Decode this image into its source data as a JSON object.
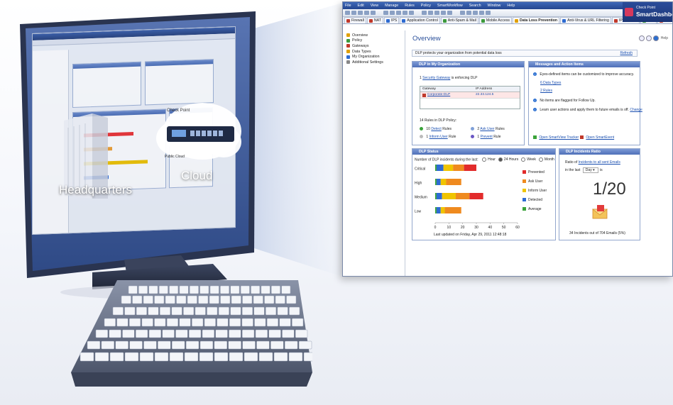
{
  "illustration": {
    "headquarters_label": "Headquarters",
    "cloud_label": "Cloud",
    "cloud_brand": "Check Point",
    "public_cloud_label": "Public Cloud"
  },
  "window": {
    "menu": [
      "File",
      "Edit",
      "View",
      "Manage",
      "Rules",
      "Policy",
      "SmartWorkflow",
      "Search",
      "Window",
      "Help"
    ],
    "brand_top": "Check Point",
    "brand_main": "SmartDashboard",
    "tabs": [
      {
        "label": "Firewall",
        "color": "#c0392b"
      },
      {
        "label": "NAT",
        "color": "#c0392b"
      },
      {
        "label": "IPS",
        "color": "#2e6bd1"
      },
      {
        "label": "Application Control",
        "color": "#2e6bd1"
      },
      {
        "label": "Anti-Spam & Mail",
        "color": "#3c9a3c"
      },
      {
        "label": "Mobile Access",
        "color": "#3c9a3c"
      },
      {
        "label": "Data Loss Prevention",
        "color": "#e0a000",
        "active": true
      },
      {
        "label": "Anti-Virus & URL Filtering",
        "color": "#2e6bd1"
      },
      {
        "label": "IPSec VPN",
        "color": "#c0392b"
      },
      {
        "label": "QoS",
        "color": "#3c9a3c"
      },
      {
        "label": "Desktop",
        "color": "#c0392b"
      }
    ]
  },
  "sidebar": {
    "items": [
      {
        "label": "Overview",
        "color": "#e0a000",
        "child": false
      },
      {
        "label": "Policy",
        "color": "#3c9a3c",
        "child": false
      },
      {
        "label": "Gateways",
        "color": "#c0392b",
        "child": false
      },
      {
        "label": "Data Types",
        "color": "#e0a000",
        "child": false
      },
      {
        "label": "My Organization",
        "color": "#2e6bd1",
        "child": false
      },
      {
        "label": "Additional Settings",
        "color": "#888888",
        "child": false
      }
    ]
  },
  "overview": {
    "title": "Overview",
    "help": "Help",
    "banner_text": "DLP protects your organization from potential data loss",
    "refresh": "Refresh"
  },
  "org_panel": {
    "title": "DLP in My Organization",
    "gateway_count": "1",
    "gateway_link": "Security Gateway",
    "gateway_suffix": "is enforcing DLP",
    "col_gateway": "Gateway",
    "col_ip": "IP Address",
    "gw_name": "Corporate-DLP",
    "gw_ip": "22.33.124.5",
    "rules_text": "14 Rules in DLP Policy:",
    "detect_count": "10",
    "detect_link": "Detect",
    "detect_suffix": "Rules",
    "ask_count": "2",
    "ask_link": "Ask User",
    "ask_suffix": "Rules",
    "inform_count": "1",
    "inform_link": "Inform User",
    "inform_suffix": "Rule",
    "prevent_count": "1",
    "prevent_link": "Prevent",
    "prevent_suffix": "Rule"
  },
  "messages_panel": {
    "title": "Messages and Action Items",
    "msg1": "Eyes-defined items can be customized to improve accuracy.",
    "link_data_types": "6 Data Types",
    "link_rules": "2 Rules",
    "msg2": "No items are flagged for Follow Up.",
    "msg3": "Learn user actions and apply them to future emails is off.",
    "change": "Change",
    "tracker": "Open SmartView Tracker",
    "smartevent": "Open SmartEvent"
  },
  "status_panel": {
    "title": "DLP Status",
    "period_label": "Number of DLP incidents during the last:",
    "periods": [
      "Hour",
      "24 Hours",
      "Week",
      "Month"
    ],
    "selected_period": "24 Hours",
    "updated": "Last updated on Friday, Apr 29, 2011 12:48:18"
  },
  "chart_data": {
    "type": "bar",
    "orientation": "horizontal",
    "stacked": true,
    "categories": [
      "Critical",
      "High",
      "Medium",
      "Low"
    ],
    "series": [
      {
        "name": "Average",
        "color": "#3aa33a",
        "values": [
          1,
          1,
          1,
          1
        ]
      },
      {
        "name": "Detected",
        "color": "#2f6bd3",
        "values": [
          5,
          3,
          4,
          3
        ]
      },
      {
        "name": "Inform User",
        "color": "#f0c400",
        "values": [
          7,
          4,
          10,
          3
        ]
      },
      {
        "name": "Ask User",
        "color": "#ef8a1f",
        "values": [
          8,
          11,
          10,
          12
        ]
      },
      {
        "name": "Prevented",
        "color": "#e22b2b",
        "values": [
          9,
          0,
          10,
          0
        ]
      }
    ],
    "xlim": [
      0,
      60
    ],
    "xticks": [
      0,
      10,
      20,
      30,
      40,
      50,
      60
    ],
    "legend_order": [
      "Prevented",
      "Ask User",
      "Inform User",
      "Detected",
      "Average"
    ],
    "legend_position": "right"
  },
  "ratio_panel": {
    "title": "DLP Incidents Ratio",
    "label_prefix": "Ratio of",
    "label_link": "Incidents to all sent Emails",
    "in_the_last": "in the last",
    "period_value": "Day",
    "is": "is",
    "ratio": "1/20",
    "footer": "34 Incidents out of 704 Emails (5%)"
  }
}
